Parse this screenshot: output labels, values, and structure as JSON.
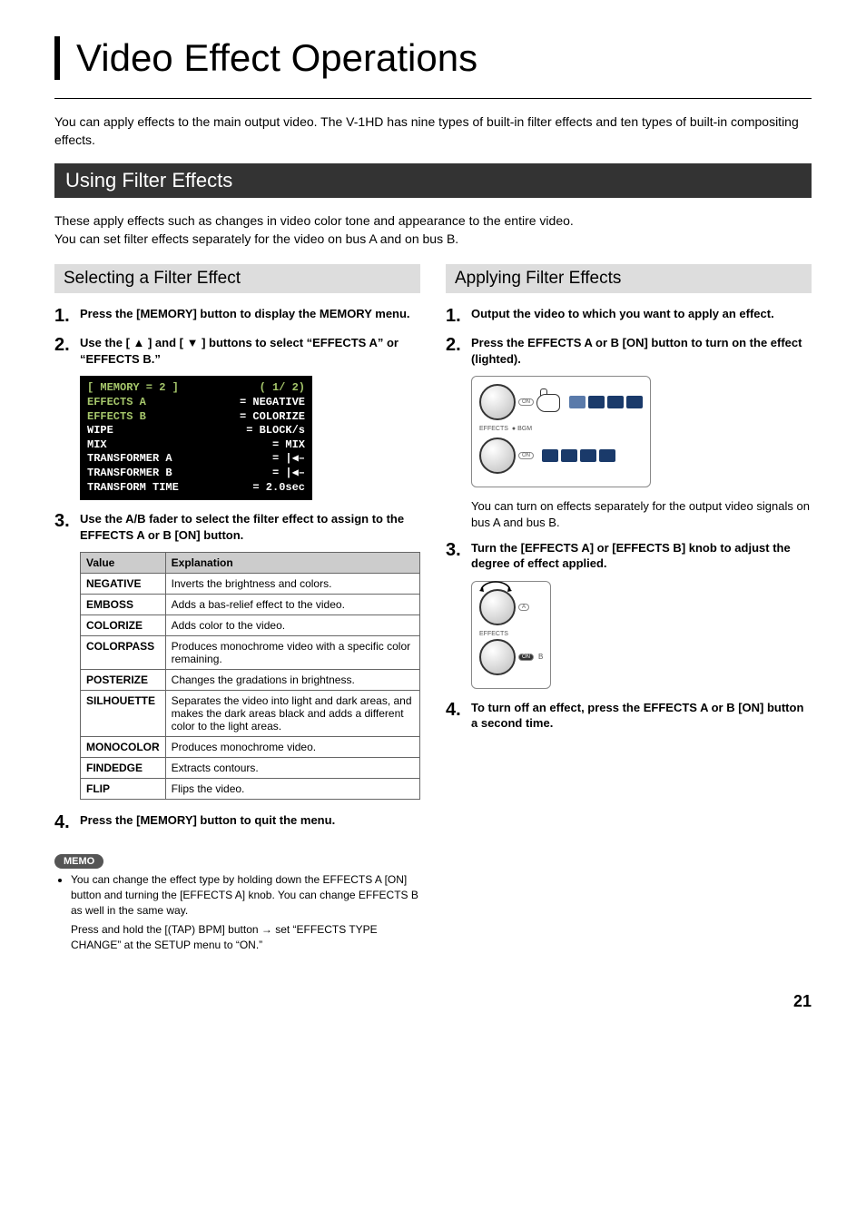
{
  "title": "Video Effect Operations",
  "intro": "You can apply effects to the main output video. The V-1HD has nine types of built-in filter effects and ten types of built-in compositing effects.",
  "section_head": "Using Filter Effects",
  "section_desc": "These apply effects such as changes in video color tone and appearance to the entire video.\nYou can set filter effects separately for the video on bus A and on bus B.",
  "left": {
    "sub_head": "Selecting a Filter Effect",
    "steps": {
      "s1": "Press the [MEMORY] button to display the MEMORY menu.",
      "s2": "Use the [ ▲ ] and [ ▼ ] buttons to select “EFFECTS A” or “EFFECTS B.”",
      "s3": "Use the A/B fader to select the filter effect to assign to the EFFECTS A or B [ON] button.",
      "s4": "Press the [MEMORY] button to quit the menu."
    },
    "screen_rows": [
      {
        "l": "[ MEMORY = 2 ]",
        "r": "( 1/ 2)",
        "accent": true
      },
      {
        "l": "EFFECTS A",
        "r": "= NEGATIVE",
        "accent_l": true
      },
      {
        "l": "EFFECTS B",
        "r": "= COLORIZE",
        "accent_l": true
      },
      {
        "l": "WIPE",
        "r": "= BLOCK/s"
      },
      {
        "l": "MIX",
        "r": "= MIX"
      },
      {
        "l": "TRANSFORMER A",
        "r": "= |◀–"
      },
      {
        "l": "TRANSFORMER B",
        "r": "= |◀–"
      },
      {
        "l": "TRANSFORM TIME",
        "r": "= 2.0sec"
      }
    ],
    "table_head": {
      "value": "Value",
      "exp": "Explanation"
    },
    "table": [
      {
        "v": "NEGATIVE",
        "e": "Inverts the brightness and colors."
      },
      {
        "v": "EMBOSS",
        "e": "Adds a bas-relief effect to the video."
      },
      {
        "v": "COLORIZE",
        "e": "Adds color to the video."
      },
      {
        "v": "COLORPASS",
        "e": "Produces monochrome video with a specific color remaining."
      },
      {
        "v": "POSTERIZE",
        "e": "Changes the gradations in brightness."
      },
      {
        "v": "SILHOUETTE",
        "e": "Separates the video into light and dark areas, and makes the dark areas black and adds a different color to the light areas."
      },
      {
        "v": "MONOCOLOR",
        "e": "Produces monochrome video."
      },
      {
        "v": "FINDEDGE",
        "e": "Extracts contours."
      },
      {
        "v": "FLIP",
        "e": "Flips the video."
      }
    ],
    "memo_label": "MEMO",
    "memo_items": [
      "You can change the effect type by holding down the EFFECTS A [ON] button and turning the [EFFECTS A] knob. You can change EFFECTS B as well in the same way.",
      "Press and hold the [(TAP) BPM] button → set “EFFECTS TYPE CHANGE” at the SETUP menu to “ON.”"
    ]
  },
  "right": {
    "sub_head": "Applying Filter Effects",
    "steps": {
      "s1": "Output the video to which you want to apply an effect.",
      "s2": "Press the EFFECTS A or B [ON] button to turn on the effect (lighted).",
      "s2_note": "You can turn on effects separately for the output video signals on bus A and bus B.",
      "s3": "Turn the [EFFECTS A] or [EFFECTS B] knob to adjust the degree of effect applied.",
      "s4": "To turn off an effect, press the EFFECTS A or B [ON] button a second time."
    },
    "illus_labels": {
      "effects": "EFFECTS",
      "on": "ON",
      "a": "A",
      "b": "B",
      "bgm": "BGM"
    }
  },
  "page_number": "21"
}
